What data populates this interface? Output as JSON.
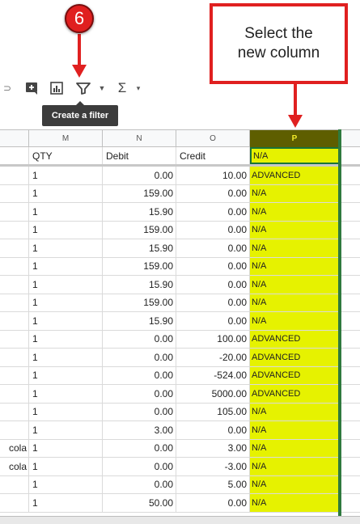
{
  "callout": {
    "step_number": "6",
    "instruction_line1": "Select the",
    "instruction_line2": "new column"
  },
  "toolbar": {
    "tooltip": "Create a filter",
    "icons": [
      "link-icon",
      "comment-icon",
      "chart-icon",
      "filter-icon",
      "chevron-down-icon",
      "sigma-icon",
      "chevron-down-icon"
    ]
  },
  "columns": [
    "M",
    "N",
    "O",
    "P"
  ],
  "header_row": {
    "m": "QTY",
    "n": "Debit",
    "o": "Credit",
    "p": "N/A"
  },
  "rows": [
    {
      "lead": "",
      "m": "1",
      "n": "0.00",
      "o": "10.00",
      "p": "ADVANCED"
    },
    {
      "lead": "",
      "m": "1",
      "n": "159.00",
      "o": "0.00",
      "p": "N/A"
    },
    {
      "lead": "",
      "m": "1",
      "n": "15.90",
      "o": "0.00",
      "p": "N/A"
    },
    {
      "lead": "",
      "m": "1",
      "n": "159.00",
      "o": "0.00",
      "p": "N/A"
    },
    {
      "lead": "",
      "m": "1",
      "n": "15.90",
      "o": "0.00",
      "p": "N/A"
    },
    {
      "lead": "",
      "m": "1",
      "n": "159.00",
      "o": "0.00",
      "p": "N/A"
    },
    {
      "lead": "",
      "m": "1",
      "n": "15.90",
      "o": "0.00",
      "p": "N/A"
    },
    {
      "lead": "",
      "m": "1",
      "n": "159.00",
      "o": "0.00",
      "p": "N/A"
    },
    {
      "lead": "",
      "m": "1",
      "n": "15.90",
      "o": "0.00",
      "p": "N/A"
    },
    {
      "lead": "",
      "m": "1",
      "n": "0.00",
      "o": "100.00",
      "p": "ADVANCED"
    },
    {
      "lead": "",
      "m": "1",
      "n": "0.00",
      "o": "-20.00",
      "p": "ADVANCED"
    },
    {
      "lead": "",
      "m": "1",
      "n": "0.00",
      "o": "-524.00",
      "p": "ADVANCED"
    },
    {
      "lead": "",
      "m": "1",
      "n": "0.00",
      "o": "5000.00",
      "p": "ADVANCED"
    },
    {
      "lead": "",
      "m": "1",
      "n": "0.00",
      "o": "105.00",
      "p": "N/A"
    },
    {
      "lead": "",
      "m": "1",
      "n": "3.00",
      "o": "0.00",
      "p": "N/A"
    },
    {
      "lead": "cola",
      "m": "1",
      "n": "0.00",
      "o": "3.00",
      "p": "N/A"
    },
    {
      "lead": "cola",
      "m": "1",
      "n": "0.00",
      "o": "-3.00",
      "p": "N/A"
    },
    {
      "lead": "",
      "m": "1",
      "n": "0.00",
      "o": "5.00",
      "p": "N/A"
    },
    {
      "lead": "",
      "m": "1",
      "n": "50.00",
      "o": "0.00",
      "p": "N/A"
    }
  ],
  "colors": {
    "highlight": "#e6f200",
    "selected_header": "#5e5e00",
    "annotation_red": "#e02020"
  }
}
